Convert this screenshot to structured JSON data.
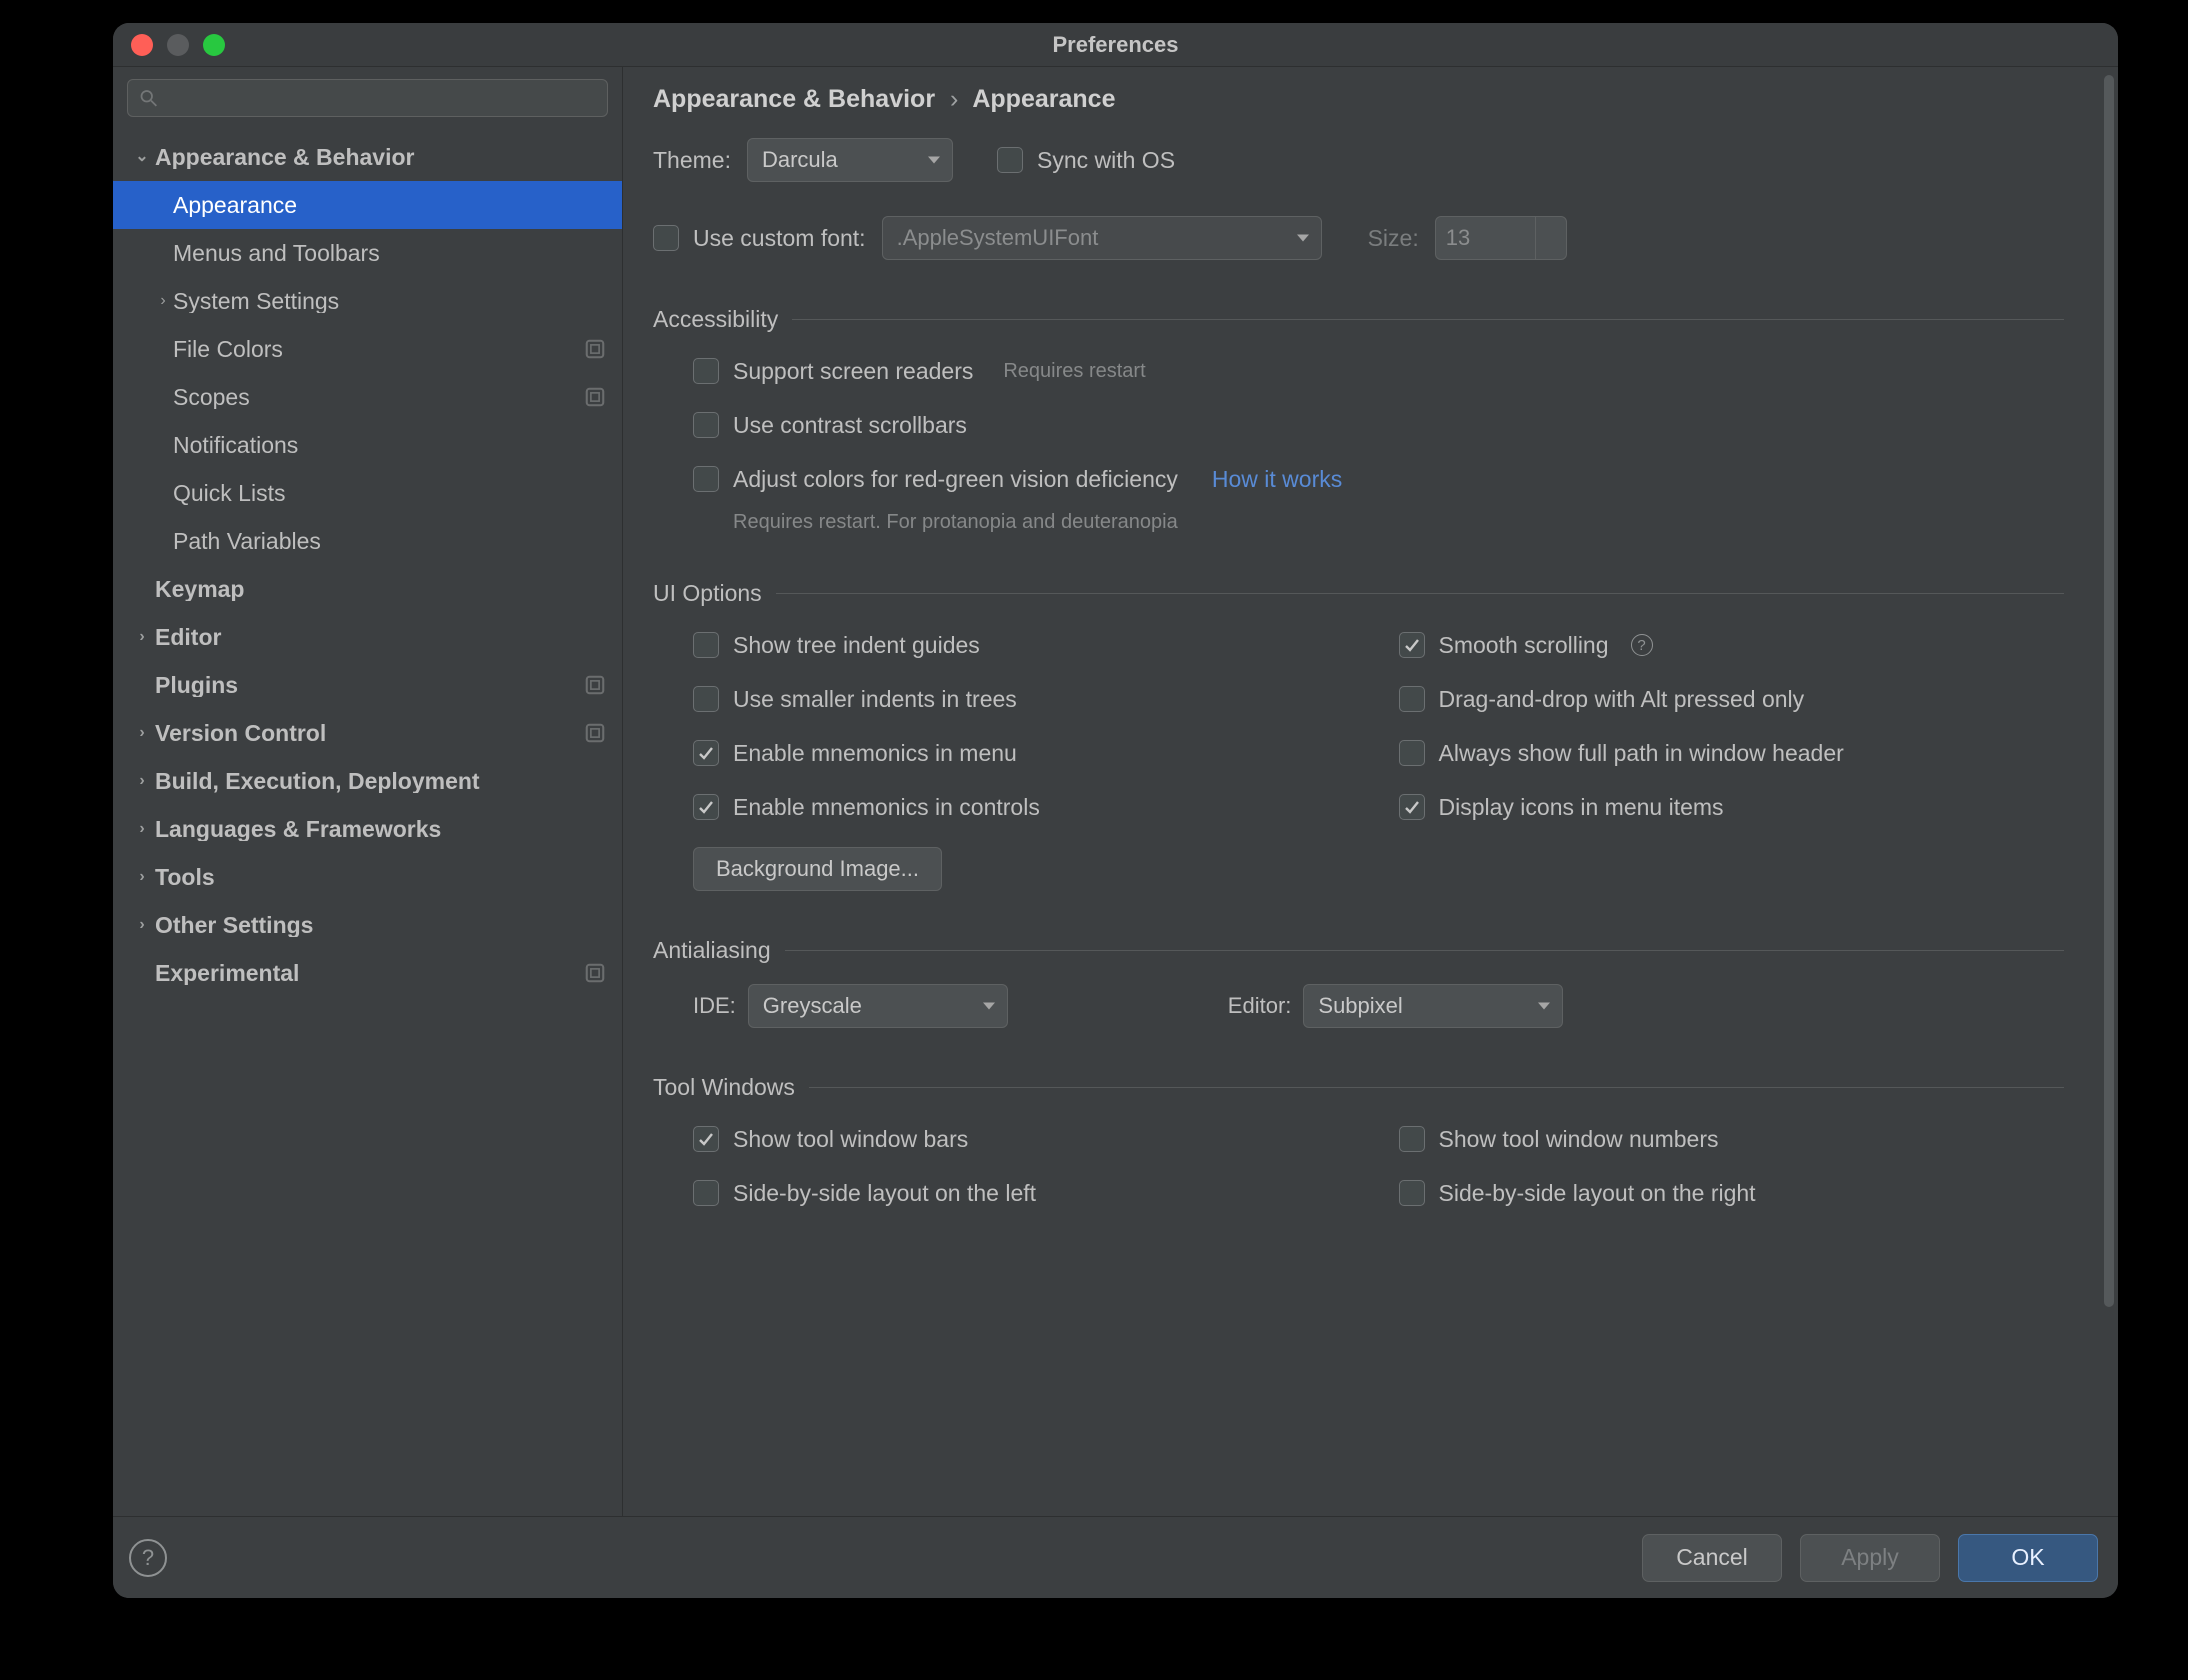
{
  "window": {
    "title": "Preferences"
  },
  "search": {
    "placeholder": ""
  },
  "sidebar": {
    "items": [
      {
        "label": "Appearance & Behavior",
        "level": 0,
        "arrow": "down",
        "selected": false,
        "badge": false
      },
      {
        "label": "Appearance",
        "level": 1,
        "arrow": "",
        "selected": true,
        "badge": false
      },
      {
        "label": "Menus and Toolbars",
        "level": 1,
        "arrow": "",
        "selected": false,
        "badge": false
      },
      {
        "label": "System Settings",
        "level": 1,
        "arrow": "right",
        "selected": false,
        "badge": false
      },
      {
        "label": "File Colors",
        "level": 1,
        "arrow": "",
        "selected": false,
        "badge": true
      },
      {
        "label": "Scopes",
        "level": 1,
        "arrow": "",
        "selected": false,
        "badge": true
      },
      {
        "label": "Notifications",
        "level": 1,
        "arrow": "",
        "selected": false,
        "badge": false
      },
      {
        "label": "Quick Lists",
        "level": 1,
        "arrow": "",
        "selected": false,
        "badge": false
      },
      {
        "label": "Path Variables",
        "level": 1,
        "arrow": "",
        "selected": false,
        "badge": false
      },
      {
        "label": "Keymap",
        "level": 0,
        "arrow": "",
        "selected": false,
        "badge": false
      },
      {
        "label": "Editor",
        "level": 0,
        "arrow": "right",
        "selected": false,
        "badge": false
      },
      {
        "label": "Plugins",
        "level": 0,
        "arrow": "",
        "selected": false,
        "badge": true
      },
      {
        "label": "Version Control",
        "level": 0,
        "arrow": "right",
        "selected": false,
        "badge": true
      },
      {
        "label": "Build, Execution, Deployment",
        "level": 0,
        "arrow": "right",
        "selected": false,
        "badge": false
      },
      {
        "label": "Languages & Frameworks",
        "level": 0,
        "arrow": "right",
        "selected": false,
        "badge": false
      },
      {
        "label": "Tools",
        "level": 0,
        "arrow": "right",
        "selected": false,
        "badge": false
      },
      {
        "label": "Other Settings",
        "level": 0,
        "arrow": "right",
        "selected": false,
        "badge": false
      },
      {
        "label": "Experimental",
        "level": 0,
        "arrow": "",
        "selected": false,
        "badge": true
      }
    ]
  },
  "breadcrumb": {
    "parent": "Appearance & Behavior",
    "sep": "›",
    "current": "Appearance"
  },
  "theme": {
    "label": "Theme:",
    "value": "Darcula",
    "sync_label": "Sync with OS"
  },
  "font": {
    "checkbox_label": "Use custom font:",
    "font_value": ".AppleSystemUIFont",
    "size_label": "Size:",
    "size_value": "13"
  },
  "accessibility": {
    "title": "Accessibility",
    "support_label": "Support screen readers",
    "support_hint": "Requires restart",
    "contrast_label": "Use contrast scrollbars",
    "adjust_label": "Adjust colors for red-green vision deficiency",
    "how_it_works": "How it works",
    "adjust_hint": "Requires restart. For protanopia and deuteranopia"
  },
  "ui_options": {
    "title": "UI Options",
    "left": [
      {
        "label": "Show tree indent guides",
        "checked": false
      },
      {
        "label": "Use smaller indents in trees",
        "checked": false
      },
      {
        "label": "Enable mnemonics in menu",
        "checked": true
      },
      {
        "label": "Enable mnemonics in controls",
        "checked": true
      }
    ],
    "right": [
      {
        "label": "Smooth scrolling",
        "checked": true,
        "info": true
      },
      {
        "label": "Drag-and-drop with Alt pressed only",
        "checked": false
      },
      {
        "label": "Always show full path in window header",
        "checked": false
      },
      {
        "label": "Display icons in menu items",
        "checked": true
      }
    ],
    "bg_button": "Background Image..."
  },
  "antialiasing": {
    "title": "Antialiasing",
    "ide_label": "IDE:",
    "ide_value": "Greyscale",
    "editor_label": "Editor:",
    "editor_value": "Subpixel"
  },
  "tool_windows": {
    "title": "Tool Windows",
    "left": [
      {
        "label": "Show tool window bars",
        "checked": true
      },
      {
        "label": "Side-by-side layout on the left",
        "checked": false
      }
    ],
    "right": [
      {
        "label": "Show tool window numbers",
        "checked": false
      },
      {
        "label": "Side-by-side layout on the right",
        "checked": false
      }
    ]
  },
  "footer": {
    "cancel": "Cancel",
    "apply": "Apply",
    "ok": "OK"
  }
}
